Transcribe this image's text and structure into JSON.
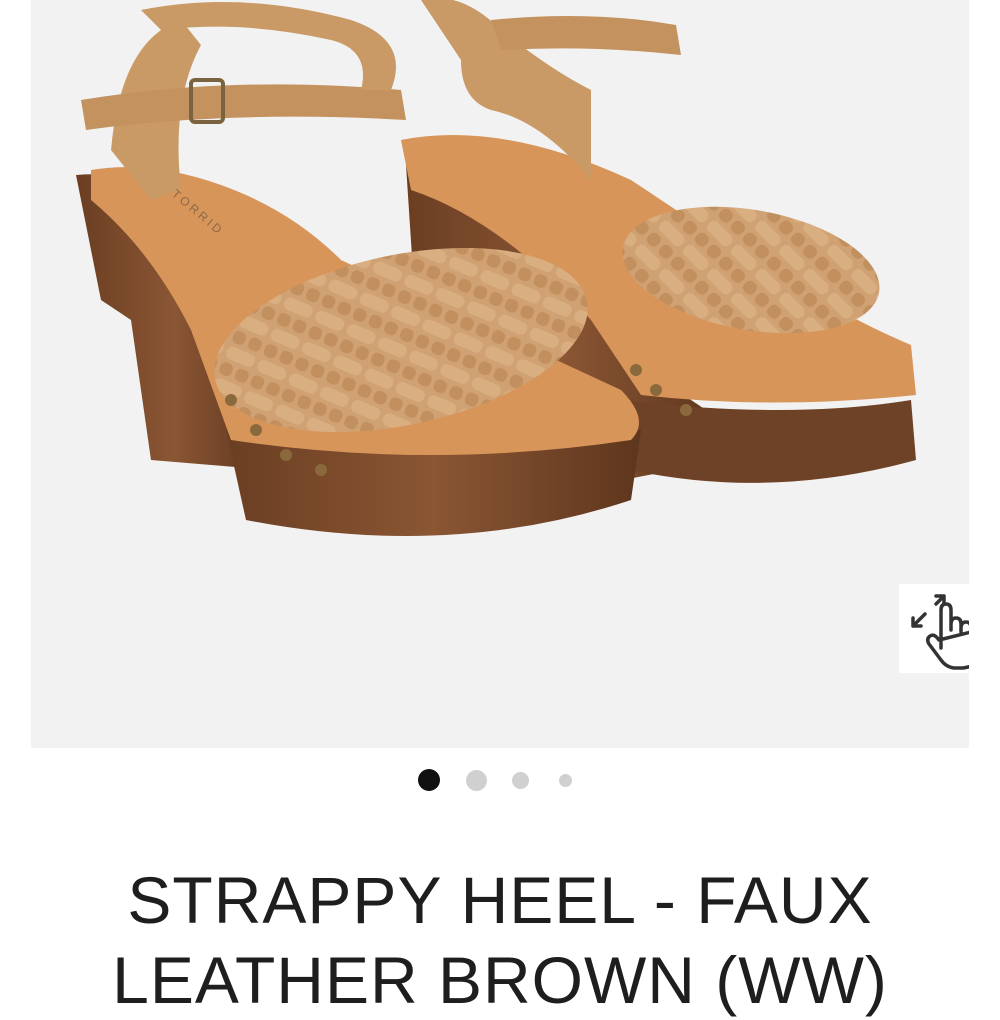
{
  "product": {
    "title_line1": "STRAPPY HEEL - FAUX",
    "title_line2": "LEATHER BROWN (WW)",
    "brand_mark": "TORRID"
  },
  "gallery": {
    "image_count": 4,
    "active_index": 0,
    "zoom_icon": "pinch-zoom-hand-icon"
  },
  "colors": {
    "gallery_bg": "#f2f2f2",
    "leather": "#c99a66",
    "sole_wood": "#7a4a2a",
    "footbed": "#d8955a",
    "dot_active": "#111111",
    "dot_inactive": "#d0d0d0",
    "title_text": "#1e1e1e"
  }
}
